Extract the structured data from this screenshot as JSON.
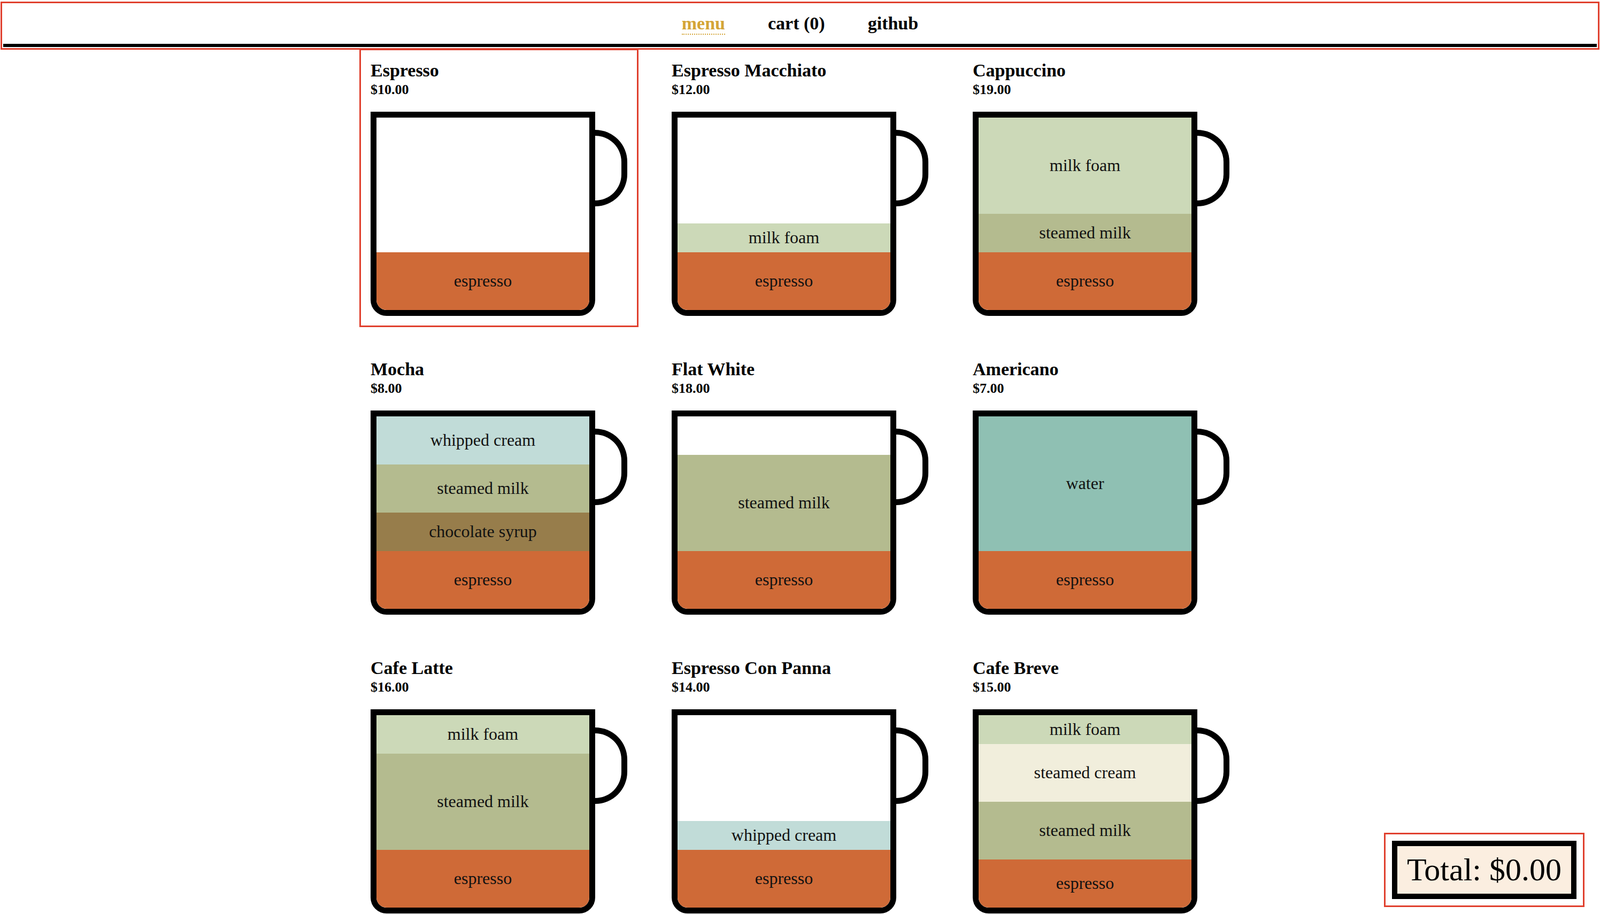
{
  "nav": {
    "highlighted": true,
    "links": [
      {
        "label": "menu",
        "selected": true
      },
      {
        "label": "cart (0)",
        "selected": false
      },
      {
        "label": "github",
        "selected": false
      }
    ]
  },
  "menu": [
    {
      "name": "Espresso",
      "price": "$10.00",
      "highlighted": true,
      "layers": [
        {
          "name": "espresso",
          "level": 0.3,
          "color": "#cf6a37"
        }
      ]
    },
    {
      "name": "Espresso Macchiato",
      "price": "$12.00",
      "highlighted": false,
      "layers": [
        {
          "name": "milk foam",
          "level": 0.15,
          "color": "#ccd9b8"
        },
        {
          "name": "espresso",
          "level": 0.3,
          "color": "#cf6a37"
        }
      ]
    },
    {
      "name": "Cappuccino",
      "price": "$19.00",
      "highlighted": false,
      "layers": [
        {
          "name": "milk foam",
          "level": 0.5,
          "color": "#ccd9b8"
        },
        {
          "name": "steamed milk",
          "level": 0.2,
          "color": "#b4bb8f"
        },
        {
          "name": "espresso",
          "level": 0.3,
          "color": "#cf6a37"
        }
      ]
    },
    {
      "name": "Mocha",
      "price": "$8.00",
      "highlighted": false,
      "layers": [
        {
          "name": "whipped cream",
          "level": 0.25,
          "color": "#c1dcd8"
        },
        {
          "name": "steamed milk",
          "level": 0.25,
          "color": "#b4bb8f"
        },
        {
          "name": "chocolate syrup",
          "level": 0.2,
          "color": "#977d4b"
        },
        {
          "name": "espresso",
          "level": 0.3,
          "color": "#cf6a37"
        }
      ]
    },
    {
      "name": "Flat White",
      "price": "$18.00",
      "highlighted": false,
      "layers": [
        {
          "name": "steamed milk",
          "level": 0.5,
          "color": "#b4bb8f"
        },
        {
          "name": "espresso",
          "level": 0.3,
          "color": "#cf6a37"
        }
      ]
    },
    {
      "name": "Americano",
      "price": "$7.00",
      "highlighted": false,
      "layers": [
        {
          "name": "water",
          "level": 0.7,
          "color": "#8fc0b3"
        },
        {
          "name": "espresso",
          "level": 0.3,
          "color": "#cf6a37"
        }
      ]
    },
    {
      "name": "Cafe Latte",
      "price": "$16.00",
      "highlighted": false,
      "layers": [
        {
          "name": "milk foam",
          "level": 0.2,
          "color": "#ccd9b8"
        },
        {
          "name": "steamed milk",
          "level": 0.5,
          "color": "#b4bb8f"
        },
        {
          "name": "espresso",
          "level": 0.3,
          "color": "#cf6a37"
        }
      ]
    },
    {
      "name": "Espresso Con Panna",
      "price": "$14.00",
      "highlighted": false,
      "layers": [
        {
          "name": "whipped cream",
          "level": 0.15,
          "color": "#c1dcd8"
        },
        {
          "name": "espresso",
          "level": 0.3,
          "color": "#cf6a37"
        }
      ]
    },
    {
      "name": "Cafe Breve",
      "price": "$15.00",
      "highlighted": false,
      "layers": [
        {
          "name": "milk foam",
          "level": 0.15,
          "color": "#ccd9b8"
        },
        {
          "name": "steamed cream",
          "level": 0.3,
          "color": "#f1eedc"
        },
        {
          "name": "steamed milk",
          "level": 0.3,
          "color": "#b4bb8f"
        },
        {
          "name": "espresso",
          "level": 0.25,
          "color": "#cf6a37"
        }
      ]
    }
  ],
  "total": {
    "label": "Total: $0.00",
    "highlighted": true
  }
}
